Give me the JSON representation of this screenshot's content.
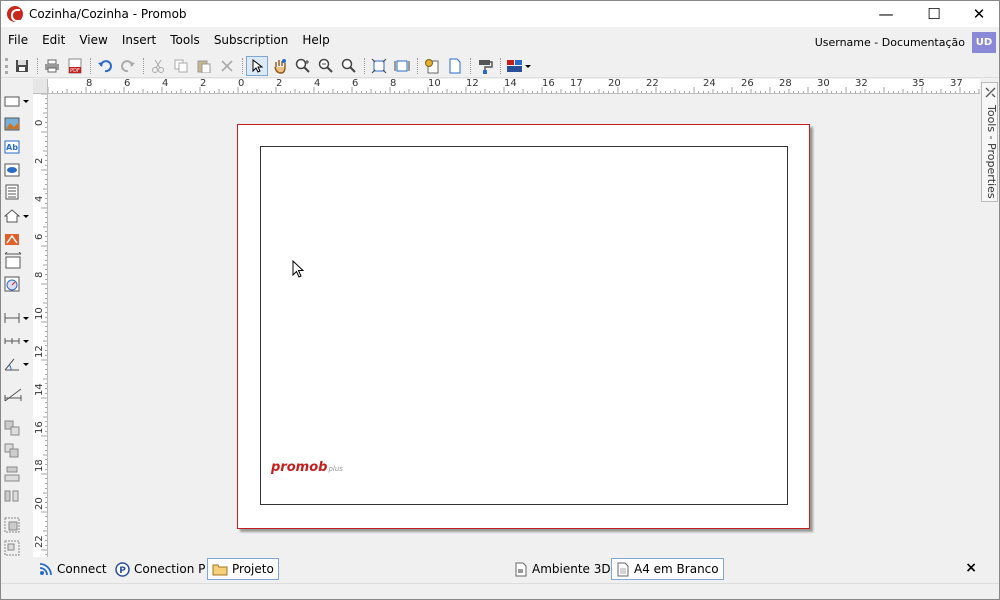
{
  "window": {
    "title": "Cozinha/Cozinha - Promob",
    "controls": {
      "minimize": "—",
      "maximize": "☐",
      "close": "✕"
    }
  },
  "menu": {
    "items": [
      "File",
      "Edit",
      "View",
      "Insert",
      "Tools",
      "Subscription",
      "Help"
    ]
  },
  "user": {
    "label": "Username - Documentação",
    "initials": "UD"
  },
  "ruler": {
    "h_labels": [
      "8",
      "6",
      "4",
      "2",
      "0",
      "2",
      "4",
      "6",
      "8",
      "10",
      "12",
      "14",
      "16",
      "17",
      "20",
      "22",
      "24",
      "26",
      "28",
      "30",
      "32",
      "35",
      "37"
    ],
    "v_labels": [
      "0",
      "2",
      "4",
      "6",
      "8",
      "10",
      "12",
      "14",
      "16",
      "18",
      "20",
      "22"
    ]
  },
  "canvas": {
    "logo_text": "promob",
    "logo_suffix": "plus"
  },
  "side_panel": {
    "tab_label": "Tools - Properties"
  },
  "bottom_tabs": {
    "left": [
      {
        "label": "Connect",
        "icon": "rss-icon"
      },
      {
        "label": "Conection P",
        "icon": "promob-p-icon"
      },
      {
        "label": "Projeto",
        "icon": "folder-icon"
      }
    ],
    "right": [
      {
        "label": "Ambiente 3D",
        "icon": "document-3d-icon"
      },
      {
        "label": "A4 em Branco",
        "icon": "document-icon"
      }
    ],
    "close": "×"
  },
  "colors": {
    "accent": "#c41f1f",
    "avatar": "#8c88d8",
    "selection": "#7fa7d6"
  }
}
